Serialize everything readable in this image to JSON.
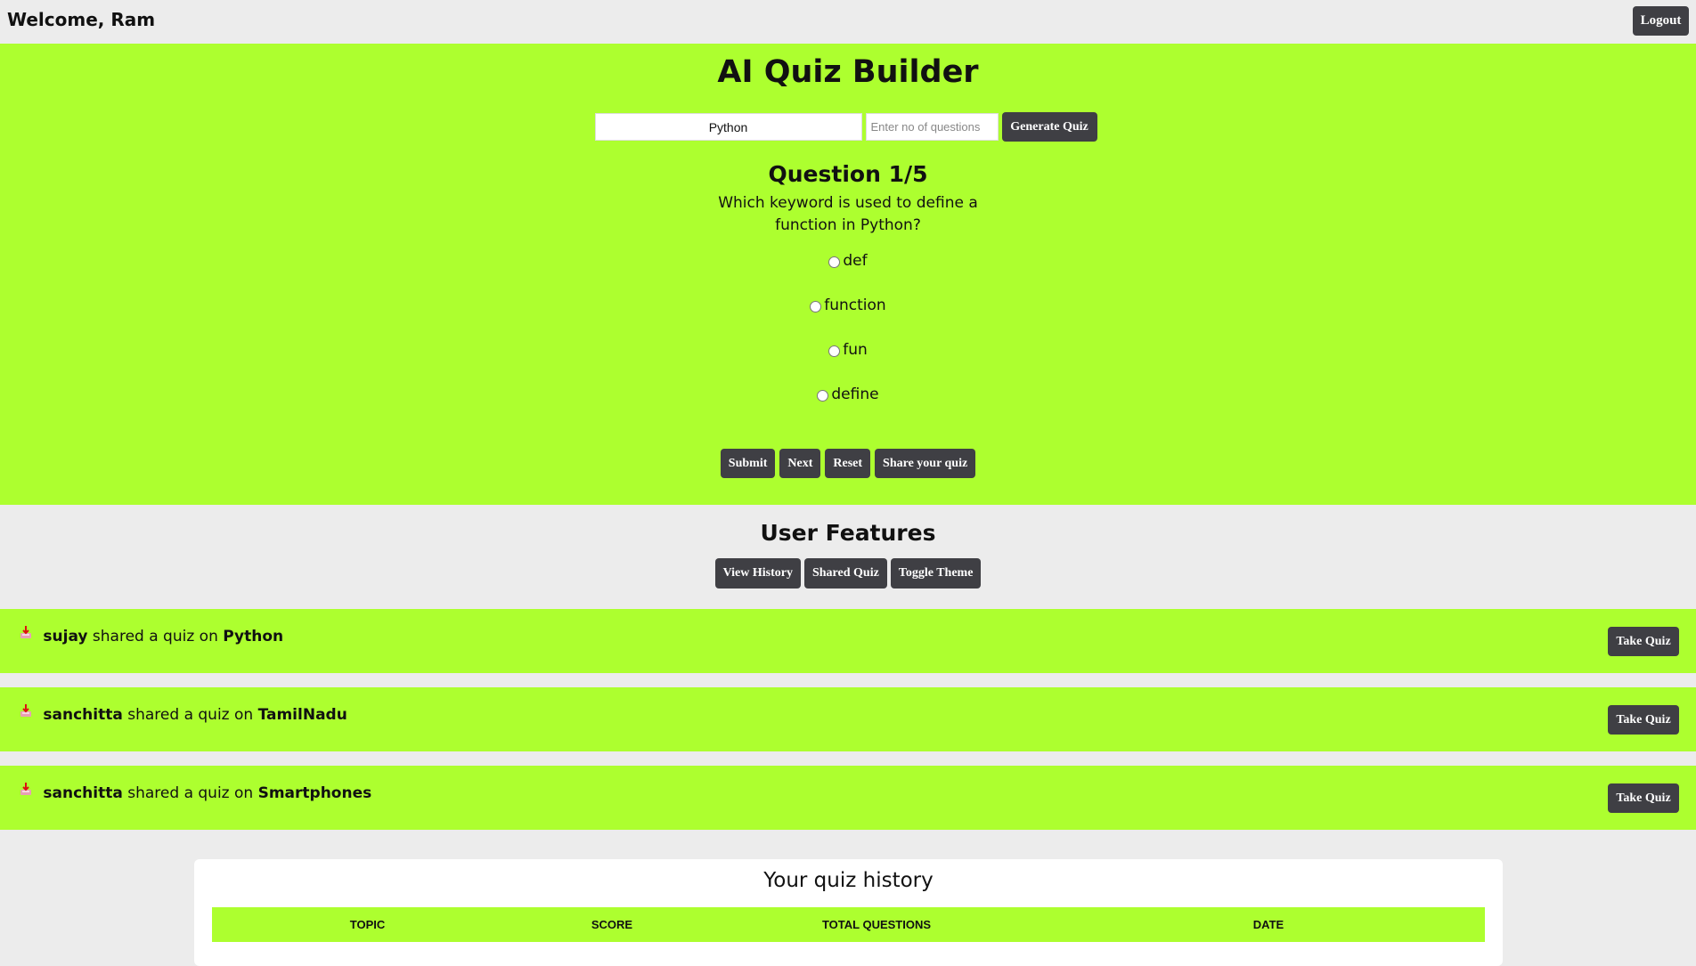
{
  "header": {
    "welcome": "Welcome, Ram",
    "logout_label": "Logout"
  },
  "quiz": {
    "title": "AI Quiz Builder",
    "topic_value": "Python",
    "count_placeholder": "Enter no of questions",
    "generate_label": "Generate Quiz",
    "question_heading": "Question 1/5",
    "question_text": "Which keyword is used to define a function in Python?",
    "options": [
      "def",
      "function",
      "fun",
      "define"
    ],
    "actions": {
      "submit": "Submit",
      "next": "Next",
      "reset": "Reset",
      "share": "Share your quiz"
    }
  },
  "features": {
    "title": "User Features",
    "view_history": "View History",
    "shared_quiz": "Shared Quiz",
    "toggle_theme": "Toggle Theme"
  },
  "shared": [
    {
      "user": "sujay",
      "middle": "shared a quiz on",
      "topic": "Python",
      "action": "Take Quiz",
      "icon": "inbox-tray-icon"
    },
    {
      "user": "sanchitta",
      "middle": "shared a quiz on",
      "topic": "TamilNadu",
      "action": "Take Quiz",
      "icon": "inbox-tray-icon"
    },
    {
      "user": "sanchitta",
      "middle": "shared a quiz on",
      "topic": "Smartphones",
      "action": "Take Quiz",
      "icon": "inbox-tray-icon"
    }
  ],
  "history": {
    "title": "Your quiz history",
    "columns": [
      "TOPIC",
      "SCORE",
      "TOTAL QUESTIONS",
      "DATE"
    ]
  },
  "colors": {
    "accent": "#adff2f",
    "button": "#3f3f44",
    "background": "#ececec"
  }
}
